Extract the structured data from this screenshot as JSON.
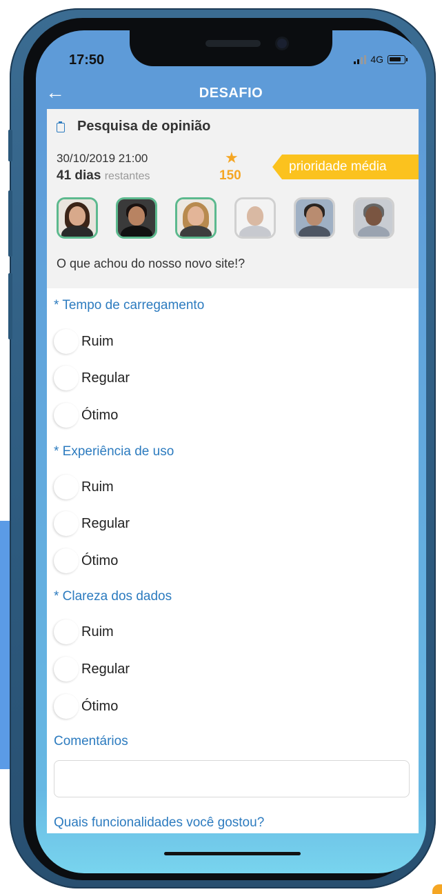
{
  "status": {
    "time": "17:50",
    "network": "4G"
  },
  "nav": {
    "back_icon": "arrow-left-icon",
    "title": "DESAFIO"
  },
  "challenge": {
    "title": "Pesquisa de opinião",
    "date": "30/10/2019 21:00",
    "days_count": "41 dias",
    "days_suffix": "restantes",
    "points": "150",
    "priority": "prioridade média",
    "question": "O que achou do nosso novo site!?",
    "accent_color": "#fbc21e"
  },
  "avatars": [
    {
      "selected": true
    },
    {
      "selected": true
    },
    {
      "selected": true
    },
    {
      "selected": false
    },
    {
      "selected": false
    },
    {
      "selected": false
    }
  ],
  "form": {
    "questions": [
      {
        "label": "* Tempo de carregamento",
        "options": [
          "Ruim",
          "Regular",
          "Ótimo"
        ]
      },
      {
        "label": "* Experiência de uso",
        "options": [
          "Ruim",
          "Regular",
          "Ótimo"
        ]
      },
      {
        "label": "* Clareza dos dados",
        "options": [
          "Ruim",
          "Regular",
          "Ótimo"
        ]
      }
    ],
    "comments_label": "Comentários",
    "comments_value": "",
    "next_question": "Quais funcionalidades você gostou?"
  }
}
